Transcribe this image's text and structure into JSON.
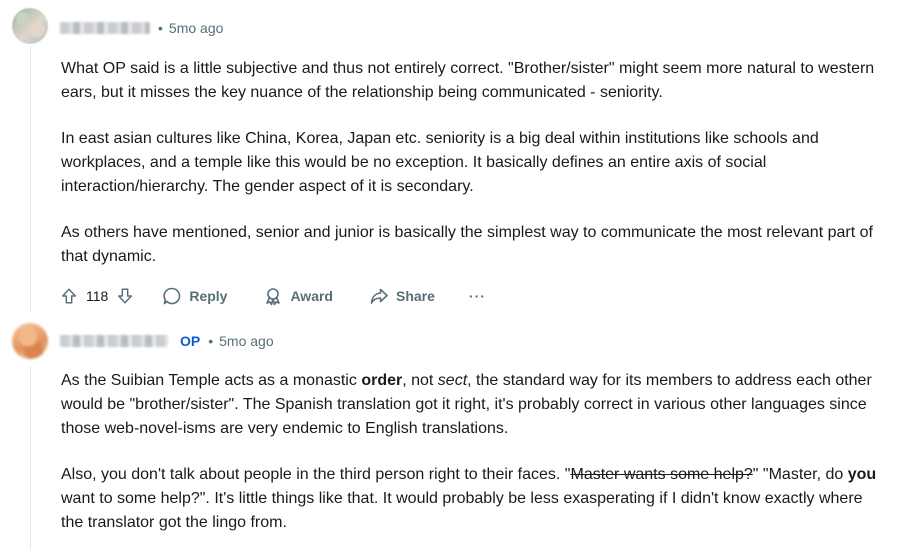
{
  "comment1": {
    "author": "",
    "time": "5mo ago",
    "paragraphs": [
      "What OP said is a little subjective and thus not entirely correct. \"Brother/sister\" might seem more natural to western ears, but it misses the key nuance of the relationship being communicated - seniority.",
      "In east asian cultures like China, Korea, Japan etc. seniority is a big deal within institutions like schools and workplaces, and a temple like this would be no exception. It basically defines an entire axis of social interaction/hierarchy. The gender aspect of it is secondary.",
      "As others have mentioned, senior and junior is basically the simplest way to communicate the most relevant part of that dynamic."
    ],
    "actions": {
      "votes": "118",
      "reply": "Reply",
      "award": "Award",
      "share": "Share",
      "more": "···"
    }
  },
  "comment2": {
    "author": "",
    "op_badge": "OP",
    "time": "5mo ago",
    "p1": {
      "a": "As the Suibian Temple acts as a monastic ",
      "b": "order",
      "c": ", not ",
      "d": "sect",
      "e": ", the standard way for its members to address each other would be \"brother/sister\". The Spanish translation got it right, it's probably correct in various other languages since those web-novel-isms are very endemic to English translations."
    },
    "p2": {
      "a": "Also, you don't talk about people in the third person right to their faces. \"",
      "b": "Master wants some help?",
      "c": "\" \"Master, do ",
      "d": "you",
      "e": " want to some help?\". It's little things like that. It would probably be less exasperating if I didn't know exactly where the translator got the lingo from."
    }
  },
  "colors": {
    "meta_text": "#576f76",
    "op_badge": "#0a5fcf",
    "body_text": "#1a1a1b"
  },
  "icons": [
    "upvote-icon",
    "downvote-icon",
    "comment-icon",
    "award-icon",
    "share-icon",
    "more-icon"
  ]
}
